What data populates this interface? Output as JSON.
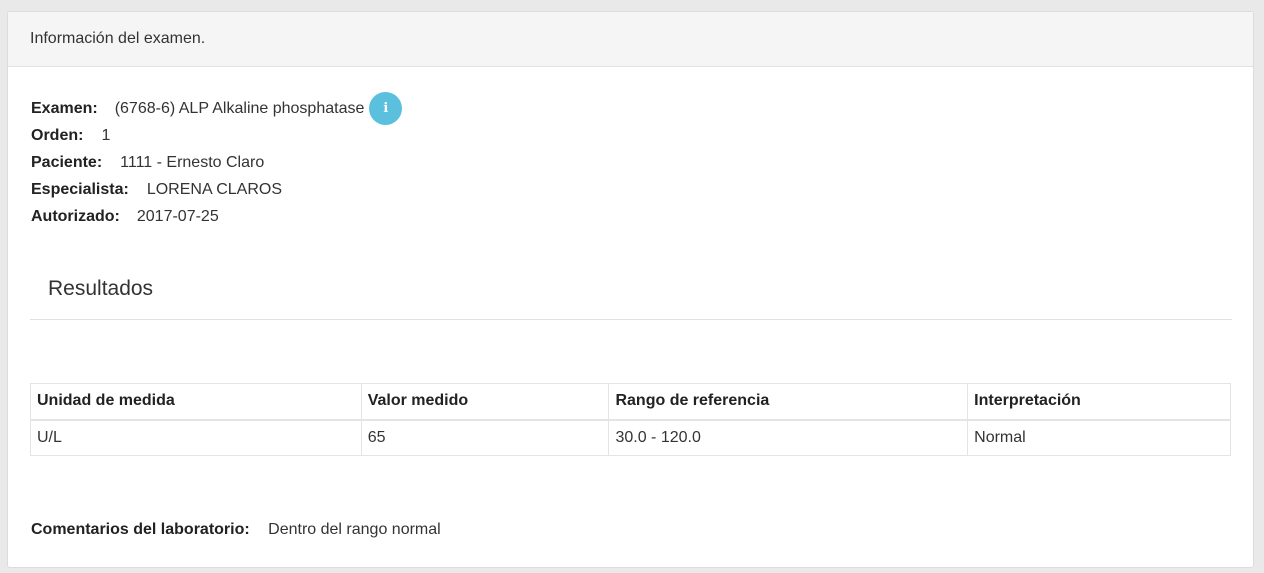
{
  "panel": {
    "heading": "Información del examen."
  },
  "exam": {
    "examen_label": "Examen:",
    "examen_value": "(6768-6) ALP Alkaline phosphatase",
    "info_icon": "info-icon",
    "orden_label": "Orden:",
    "orden_value": "1",
    "paciente_label": "Paciente:",
    "paciente_value": "1111 - Ernesto Claro",
    "especialista_label": "Especialista:",
    "especialista_value": "LORENA CLAROS",
    "autorizado_label": "Autorizado:",
    "autorizado_value": "2017-07-25"
  },
  "results": {
    "title": "Resultados",
    "columns": [
      "Unidad de medida",
      "Valor medido",
      "Rango de referencia",
      "Interpretación"
    ],
    "rows": [
      [
        "U/L",
        "65",
        "30.0 - 120.0",
        "Normal"
      ]
    ]
  },
  "comments": {
    "label": "Comentarios del laboratorio:",
    "value": "Dentro del rango normal"
  },
  "colors": {
    "info_icon_bg": "#5bc0de",
    "heading_bg": "#f5f5f6"
  }
}
